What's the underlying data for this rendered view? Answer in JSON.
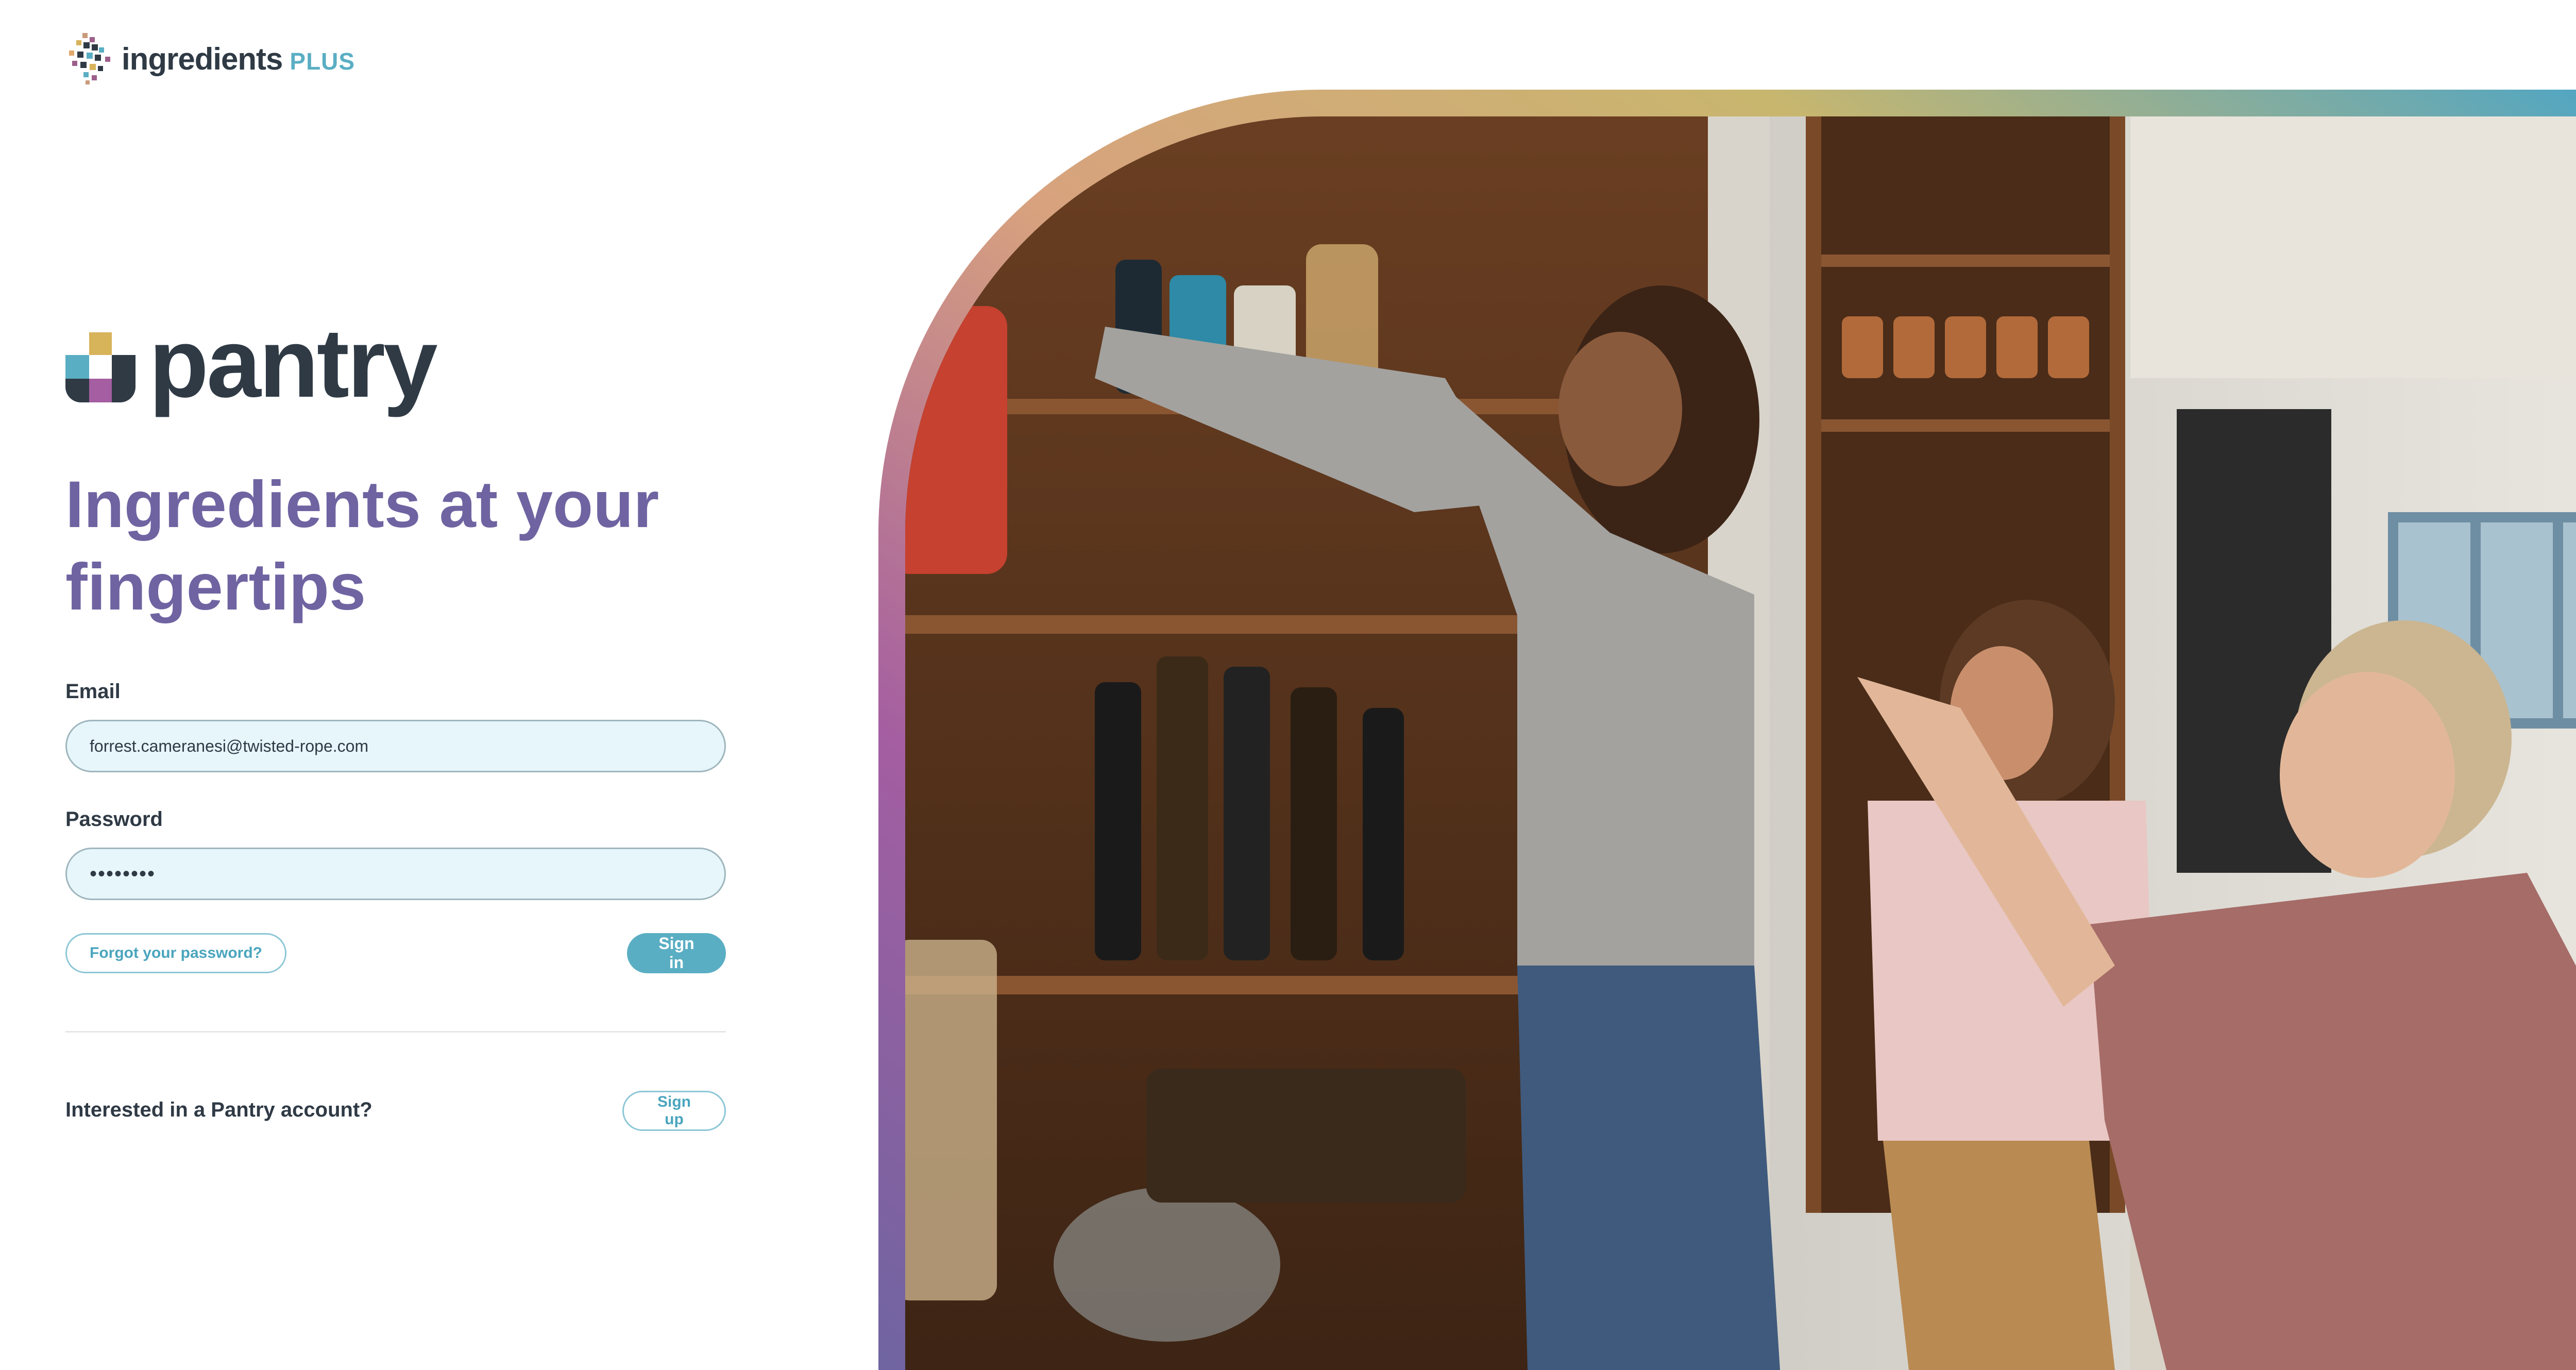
{
  "brand": {
    "name": "ingredients",
    "suffix": "PLUS"
  },
  "product": {
    "name": "pantry"
  },
  "headline": {
    "line1": "Ingredients at your",
    "line2": "fingertips"
  },
  "form": {
    "email_label": "Email",
    "email_value": "forrest.cameranesi@twisted-rope.com",
    "password_label": "Password",
    "password_value": "••••••••",
    "forgot_label": "Forgot your password?",
    "signin_label": "Sign in"
  },
  "signup": {
    "prompt": "Interested in a Pantry account?",
    "button_label": "Sign up"
  },
  "colors": {
    "accent": "#5aaec3",
    "headline": "#6f64a1",
    "text": "#2f3a45",
    "field_bg": "#e6f6fb"
  },
  "hero": {
    "icon": "pantry-family-photo"
  }
}
